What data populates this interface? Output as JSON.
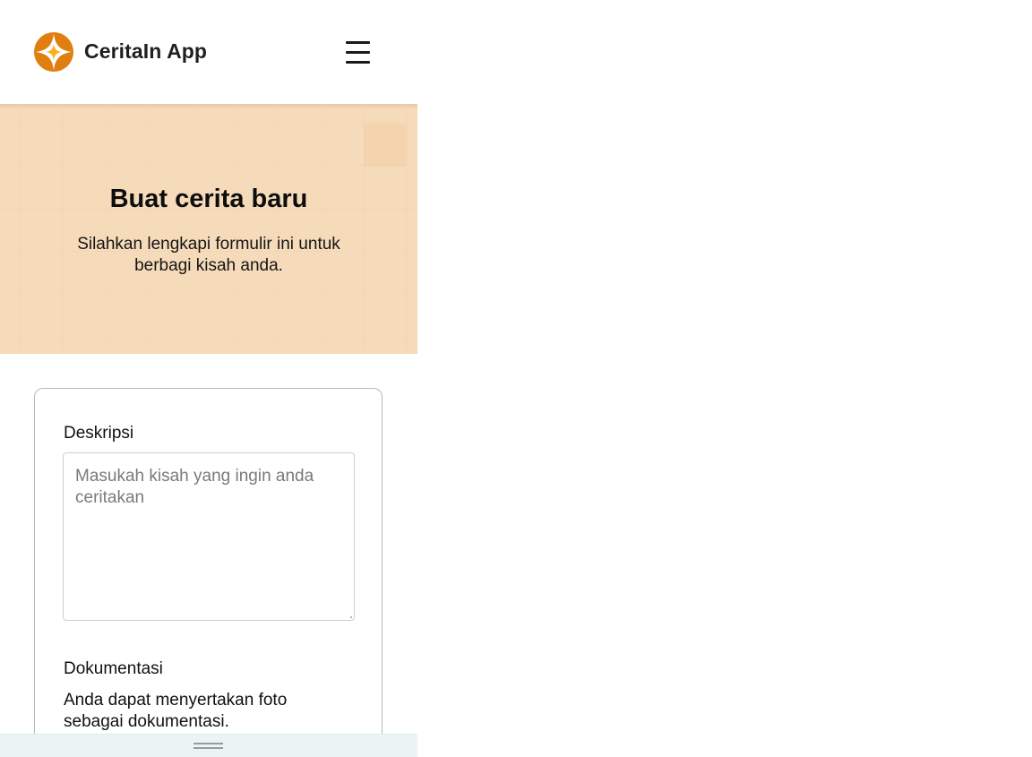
{
  "header": {
    "app_name": "CeritaIn App",
    "logo_icon": "compass-star-icon",
    "menu_icon": "hamburger-menu-icon"
  },
  "hero": {
    "title": "Buat cerita baru",
    "subtitle": "Silahkan lengkapi formulir ini untuk berbagi kisah anda."
  },
  "form": {
    "description": {
      "label": "Deskripsi",
      "placeholder": "Masukah kisah yang ingin anda ceritakan",
      "value": ""
    },
    "documentation": {
      "label": "Dokumentasi",
      "help_text": "Anda dapat menyertakan foto sebagai dokumentasi."
    }
  },
  "colors": {
    "brand": "#e07e10",
    "hero_background": "#f6dbbb",
    "drawer_background": "#eaf4f4"
  }
}
